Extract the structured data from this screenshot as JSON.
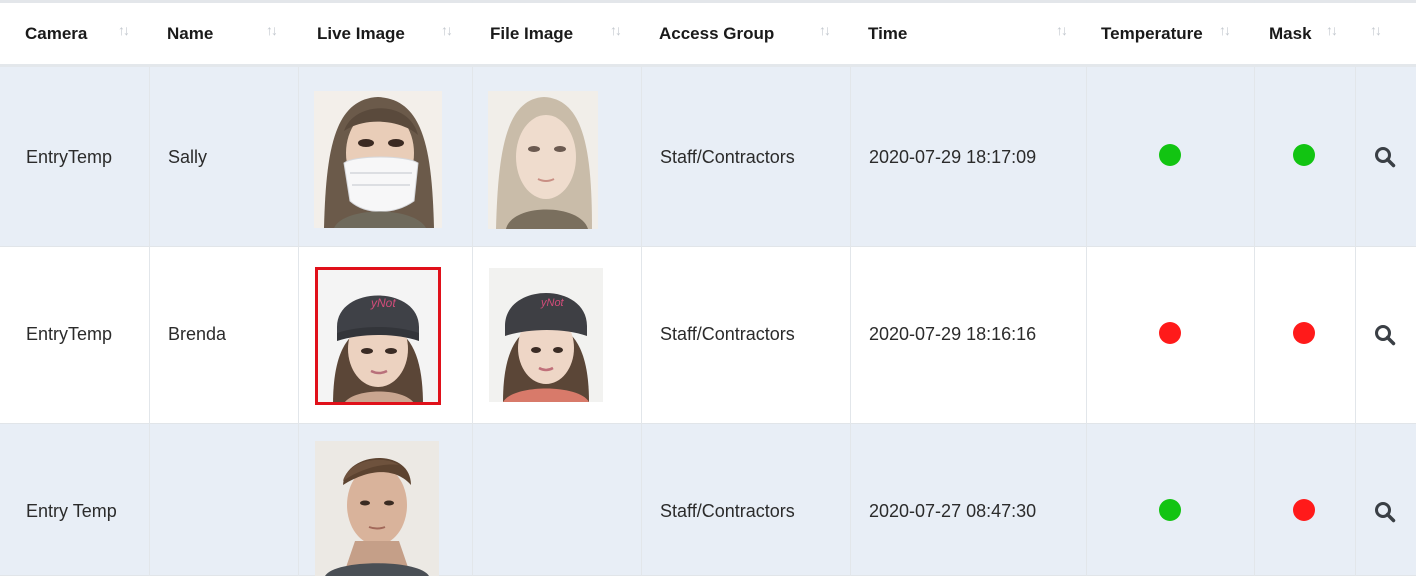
{
  "columns": [
    {
      "label": "Camera"
    },
    {
      "label": "Name"
    },
    {
      "label": "Live Image"
    },
    {
      "label": "File Image"
    },
    {
      "label": "Access Group"
    },
    {
      "label": "Time"
    },
    {
      "label": "Temperature"
    },
    {
      "label": "Mask"
    },
    {
      "label": ""
    }
  ],
  "sort_glyph": "↑↓",
  "rows": [
    {
      "camera": "EntryTemp",
      "name": "Sally",
      "access_group": "Staff/Contractors",
      "time": "2020-07-29 18:17:09",
      "temperature_status": "ok",
      "mask_status": "ok",
      "live_highlight": false
    },
    {
      "camera": "EntryTemp",
      "name": "Brenda",
      "access_group": "Staff/Contractors",
      "time": "2020-07-29 18:16:16",
      "temperature_status": "alert",
      "mask_status": "alert",
      "live_highlight": true
    },
    {
      "camera": "Entry Temp",
      "name": "",
      "access_group": "Staff/Contractors",
      "time": "2020-07-27 08:47:30",
      "temperature_status": "ok",
      "mask_status": "alert",
      "live_highlight": false
    }
  ],
  "colors": {
    "ok": "#12c412",
    "alert": "#ff1a1a",
    "highlight": "#e0101a"
  },
  "icons": {
    "action": "search-icon",
    "sort": "sort-arrows-icon"
  }
}
